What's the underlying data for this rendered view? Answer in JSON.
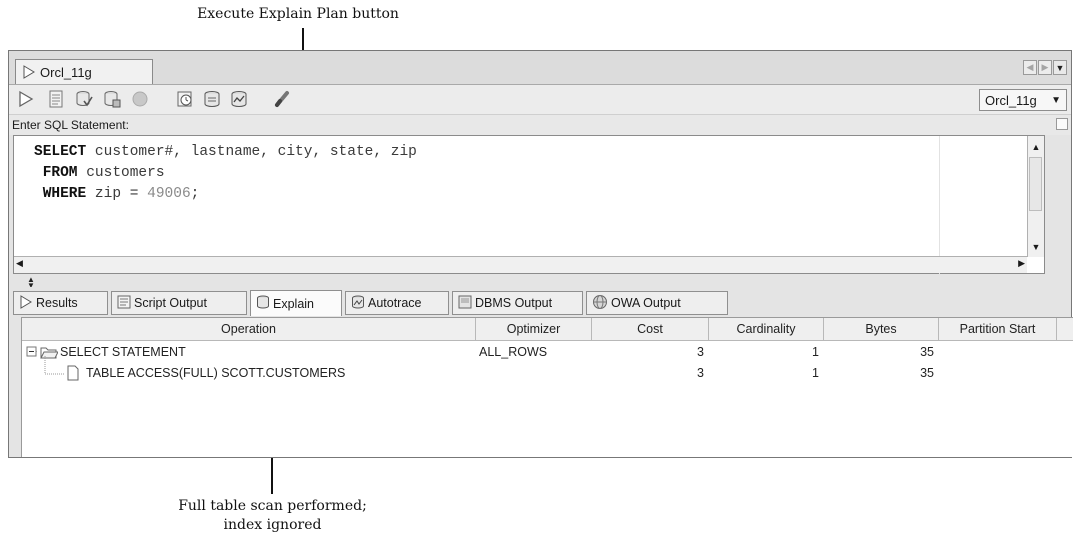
{
  "callouts": {
    "top": "Execute Explain Plan button",
    "bottom_line1": "Full table scan performed;",
    "bottom_line2": "index ignored"
  },
  "window": {
    "tab_label": "Orcl_11g",
    "connection": "Orcl_11g",
    "sql_label": "Enter SQL Statement:"
  },
  "toolbar": {
    "icons": [
      "run-statement-icon",
      "run-script-icon",
      "commit-icon",
      "rollback-icon",
      "cancel-icon",
      "sql-history-icon",
      "explain-plan-icon",
      "autotrace-icon",
      "clear-icon"
    ]
  },
  "editor": {
    "line1_kw": "SELECT",
    "line1_rest": " customer#, lastname, city, state, zip",
    "line2_kw": "FROM",
    "line2_rest": " customers",
    "line3_kw": "WHERE",
    "line3_rest": " zip = ",
    "line3_num": "49006",
    "line3_end": ";"
  },
  "output_tabs": [
    "Results",
    "Script Output",
    "Explain",
    "Autotrace",
    "DBMS Output",
    "OWA Output"
  ],
  "active_output_tab": "Explain",
  "explain": {
    "columns": [
      "Operation",
      "Optimizer",
      "Cost",
      "Cardinality",
      "Bytes",
      "Partition Start"
    ],
    "rows": [
      {
        "operation": "SELECT STATEMENT",
        "optimizer": "ALL_ROWS",
        "cost": "3",
        "cardinality": "1",
        "bytes": "35"
      },
      {
        "operation": "TABLE ACCESS(FULL) SCOTT.CUSTOMERS",
        "optimizer": "",
        "cost": "3",
        "cardinality": "1",
        "bytes": "35"
      }
    ]
  }
}
